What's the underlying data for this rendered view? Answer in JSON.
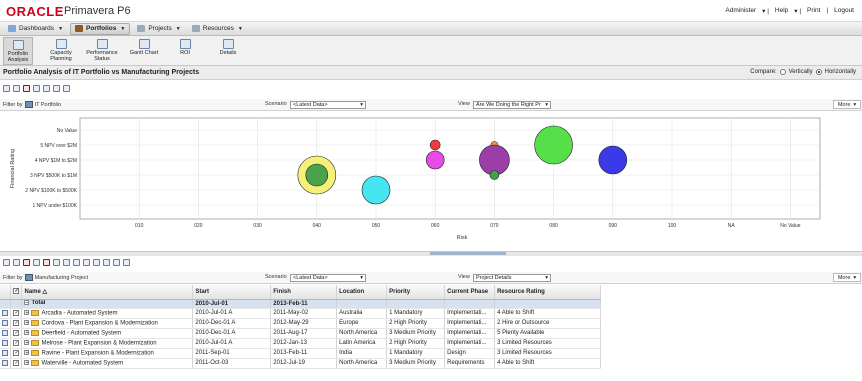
{
  "header": {
    "logo": "ORACLE",
    "product": "Primavera P6",
    "links": [
      "Administer",
      "Help",
      "Print",
      "Logout"
    ]
  },
  "menubar": [
    {
      "label": "Dashboards",
      "active": false,
      "icon_color": "#7fa6d6"
    },
    {
      "label": "Portfolios",
      "active": true,
      "icon_color": "#8a5a2b"
    },
    {
      "label": "Projects",
      "active": false,
      "icon_color": "#9aa9bd"
    },
    {
      "label": "Resources",
      "active": false,
      "icon_color": "#9aa9bd"
    }
  ],
  "tabs": [
    {
      "label": "Portfolio\nAnalysis",
      "active": true
    },
    {
      "label": "Capacity\nPlanning",
      "active": false
    },
    {
      "label": "Performance\nStatus",
      "active": false
    },
    {
      "label": "Gantt Chart",
      "active": false
    },
    {
      "label": "ROI",
      "active": false
    },
    {
      "label": "Details",
      "active": false
    }
  ],
  "titlebar": {
    "title": "Portfolio Analysis of IT Portfolio vs Manufacturing Projects",
    "compare_label": "Compare:",
    "vertically": "Vertically",
    "horizontally": "Horizontally",
    "selected": "horizontally"
  },
  "top_filter": {
    "filter_by": "Filter by",
    "portfolio": "IT Portfolio",
    "scenario_label": "Scenario",
    "scenario_value": "<Latest Data>",
    "view_label": "View",
    "view_value": "Are We Doing the Right Pr",
    "more": "More"
  },
  "chart_data": {
    "type": "scatter",
    "xlabel": "Risk",
    "ylabel": "Financial Rating",
    "x_categories": [
      "010",
      "020",
      "030",
      "040",
      "050",
      "060",
      "070",
      "080",
      "090",
      "100",
      "NA",
      "No Value"
    ],
    "y_categories": [
      "1 NPV under $100K",
      "2 NPV $100K to $500K",
      "3 NPV $500K to $1M",
      "4 NPV $1M to $2M",
      "5 NPV over $2M",
      "No Value"
    ],
    "points": [
      {
        "x": "040",
        "y": "3 NPV $500K to $1M",
        "size": 38,
        "color": "#f5f07a",
        "stroke": "#222"
      },
      {
        "x": "040",
        "y": "3 NPV $500K to $1M",
        "size": 22,
        "color": "#4aa24a",
        "stroke": "#222"
      },
      {
        "x": "050",
        "y": "2 NPV $100K to $500K",
        "size": 28,
        "color": "#45e6f2",
        "stroke": "#222"
      },
      {
        "x": "060",
        "y": "5 NPV over $2M",
        "size": 10,
        "color": "#f23a3a",
        "stroke": "#222"
      },
      {
        "x": "060",
        "y": "4 NPV $1M to $2M",
        "size": 18,
        "color": "#e84ae8",
        "stroke": "#222"
      },
      {
        "x": "070",
        "y": "5 NPV over $2M",
        "size": 7,
        "color": "#f29a3a",
        "stroke": "#222"
      },
      {
        "x": "070",
        "y": "4 NPV $1M to $2M",
        "size": 30,
        "color": "#9b3fa6",
        "stroke": "#222"
      },
      {
        "x": "070",
        "y": "3 NPV $500K to $1M",
        "size": 9,
        "color": "#3ea04a",
        "stroke": "#222"
      },
      {
        "x": "080",
        "y": "5 NPV over $2M",
        "size": 38,
        "color": "#55e04a",
        "stroke": "#222"
      },
      {
        "x": "090",
        "y": "4 NPV $1M to $2M",
        "size": 28,
        "color": "#3a3ae8",
        "stroke": "#222"
      }
    ]
  },
  "bottom_filter": {
    "filter_by": "Filter by",
    "portfolio": "Manufacturing Project",
    "scenario_label": "Scenario",
    "scenario_value": "<Latest Data>",
    "view_label": "View",
    "view_value": "Project Details",
    "more": "More"
  },
  "table": {
    "columns": [
      "Name",
      "Start",
      "Finish",
      "Location",
      "Priority",
      "Current Phase",
      "Resource Rating"
    ],
    "total": {
      "name": "Total",
      "start": "2010-Jul-01",
      "finish": "2013-Feb-11"
    },
    "rows": [
      [
        "Arcadia - Automated System",
        "2010-Jul-01 A",
        "2011-May-02",
        "Australia",
        "1 Mandatory",
        "Implementati...",
        "4 Able to Shift"
      ],
      [
        "Cordova - Plant Expansion & Modernization",
        "2010-Dec-01 A",
        "2012-May-29",
        "Europe",
        "2 High Priority",
        "Implementati...",
        "2 Hire or Outsource"
      ],
      [
        "Deerfield - Automated System",
        "2010-Dec-01 A",
        "2011-Aug-17",
        "North America",
        "3 Medium Priority",
        "Implementati...",
        "5 Plenty Available"
      ],
      [
        "Melrose - Plant Expansion & Modernization",
        "2010-Jul-01 A",
        "2012-Jan-13",
        "Latin America",
        "2 High Priority",
        "Implementati...",
        "3 Limited Resources"
      ],
      [
        "Ravine - Plant Expansion & Modernization",
        "2011-Sep-01",
        "2013-Feb-11",
        "India",
        "1 Mandatory",
        "Design",
        "3 Limited Resources"
      ],
      [
        "Waterville - Automated System",
        "2011-Oct-03",
        "2012-Jul-19",
        "North America",
        "3 Medium Priority",
        "Requirements",
        "4 Able to Shift"
      ]
    ]
  }
}
